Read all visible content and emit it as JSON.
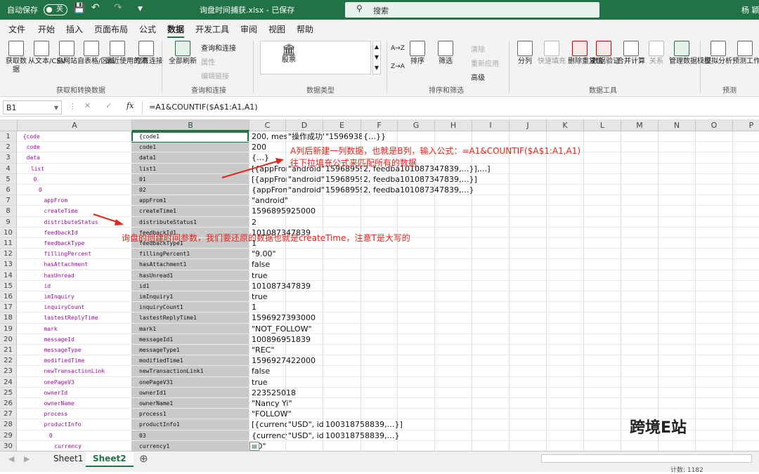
{
  "titlebar": {
    "autosave": "自动保存",
    "toggle": "关",
    "filename": "询盘时间捕获.xlsx - 已保存",
    "search": "搜索",
    "user": "杨 颖"
  },
  "tabs": [
    "文件",
    "开始",
    "插入",
    "页面布局",
    "公式",
    "数据",
    "开发工具",
    "审阅",
    "视图",
    "帮助"
  ],
  "ribbon": {
    "get": [
      "获取数据",
      "从文本/CSV",
      "自网站",
      "自表格/区域",
      "最近使用的源",
      "现有连接"
    ],
    "get_group": "获取和转换数据",
    "refresh": "全部刷新",
    "queries": "查询和连接",
    "props": "属性",
    "edit_links": "编辑链接",
    "query_group": "查询和连接",
    "stock": "股票",
    "types_group": "数据类型",
    "sort_az": "A→Z",
    "sort_za": "Z→A",
    "sort": "排序",
    "filter": "筛选",
    "clear": "清除",
    "reapply": "重新应用",
    "advanced": "高级",
    "sort_group": "排序和筛选",
    "tools": [
      "分列",
      "快速填充",
      "删除重复值",
      "数据验证",
      "合并计算",
      "关系",
      "管理数据模型"
    ],
    "tools_group": "数据工具",
    "forecast": [
      "模拟分析",
      "预测工作表"
    ],
    "forecast_group": "预测"
  },
  "formula_bar": {
    "namebox": "B1",
    "fx": "fx",
    "formula": "=A1&COUNTIF($A$1:A1,A1)"
  },
  "columns": [
    "A",
    "B",
    "C",
    "D",
    "E",
    "F",
    "G",
    "H",
    "I",
    "J",
    "K",
    "L",
    "M",
    "N",
    "O",
    "P"
  ],
  "rows": [
    {
      "n": "1",
      "a": "{code",
      "b": "{code1",
      "c": "200, mess",
      "d": "\"操作成功\"",
      "e": "\"1596938",
      "f": "{…}}"
    },
    {
      "n": "2",
      "a": "code",
      "b": "code1",
      "c": "200"
    },
    {
      "n": "3",
      "a": "data",
      "b": "data1",
      "c": "{…}"
    },
    {
      "n": "4",
      "a": "list",
      "b": "list1",
      "c": "[{appFron",
      "d": "\"android\"",
      "e": "15968959",
      "f": "2, feedba",
      "g": "101087347839,…}],…]"
    },
    {
      "n": "5",
      "a": "0",
      "b": "01",
      "c": "[{appFron",
      "d": "\"android\"",
      "e": "15968959",
      "f": "2, feedba",
      "g": "101087347839,…}]"
    },
    {
      "n": "6",
      "a": "0",
      "b": "02",
      "c": "{appFron",
      "d": "\"android\"",
      "e": "15968959",
      "f": "2, feedba",
      "g": "101087347839,…}"
    },
    {
      "n": "7",
      "a": "appFrom",
      "b": "appFrom1",
      "c": "\"android\""
    },
    {
      "n": "8",
      "a": "createTime",
      "b": "createTime1",
      "c": "1596895925000"
    },
    {
      "n": "9",
      "a": "distributeStatus",
      "b": "distributeStatus1",
      "c": "2"
    },
    {
      "n": "10",
      "a": "feedbackId",
      "b": "feedbackId1",
      "c": "101087347839"
    },
    {
      "n": "11",
      "a": "feedbackType",
      "b": "feedbackType1",
      "c": "1"
    },
    {
      "n": "12",
      "a": "fillingPercent",
      "b": "fillingPercent1",
      "c": "\"9.00\""
    },
    {
      "n": "13",
      "a": "hasAttachment",
      "b": "hasAttachment1",
      "c": "false"
    },
    {
      "n": "14",
      "a": "hasUnread",
      "b": "hasUnread1",
      "c": "true"
    },
    {
      "n": "15",
      "a": "id",
      "b": "id1",
      "c": "101087347839"
    },
    {
      "n": "16",
      "a": "imInquiry",
      "b": "imInquiry1",
      "c": "true"
    },
    {
      "n": "17",
      "a": "inquiryCount",
      "b": "inquiryCount1",
      "c": "1"
    },
    {
      "n": "18",
      "a": "lastestReplyTime",
      "b": "lastestReplyTime1",
      "c": "1596927393000"
    },
    {
      "n": "19",
      "a": "mark",
      "b": "mark1",
      "c": "\"NOT_FOLLOW\""
    },
    {
      "n": "20",
      "a": "messageId",
      "b": "messageId1",
      "c": "100896951839"
    },
    {
      "n": "21",
      "a": "messageType",
      "b": "messageType1",
      "c": "\"REC\""
    },
    {
      "n": "22",
      "a": "modifiedTime",
      "b": "modifiedTime1",
      "c": "1596927422000"
    },
    {
      "n": "23",
      "a": "newTransactionLink",
      "b": "newTransactionLink1",
      "c": "false"
    },
    {
      "n": "24",
      "a": "onePageV3",
      "b": "onePageV31",
      "c": "true"
    },
    {
      "n": "25",
      "a": "ownerId",
      "b": "ownerId1",
      "c": "223525018"
    },
    {
      "n": "26",
      "a": "ownerName",
      "b": "ownerName1",
      "c": "\"Nancy Yi\""
    },
    {
      "n": "27",
      "a": "process",
      "b": "process1",
      "c": "\"FOLLOW\""
    },
    {
      "n": "28",
      "a": "productInfo",
      "b": "productInfo1",
      "c": "[{currency",
      "d": "\"USD\", id",
      "e": "100318758839,…}]"
    },
    {
      "n": "29",
      "a": "0",
      "b": "03",
      "c": "{currency",
      "d": "\"USD\", id",
      "e": "100318758839,…}"
    },
    {
      "n": "30",
      "a": "currency",
      "b": "currency1",
      "c": "SD\""
    }
  ],
  "annotations": {
    "note1": "A列后新建一列数据，也就是B列，输入公式：=A1&COUNTIF($A$1:A1,A1)",
    "note2": "往下拉填充公式来匹配所有的数据",
    "note3": "询盘的创建时间参数，我们要还原的数据也就是createTime，注意T是大写的"
  },
  "sheets": [
    "Sheet1",
    "Sheet2"
  ],
  "watermark": "跨境E站",
  "status": "计数: 1182",
  "colors": {
    "accent": "#217346",
    "annotation": "#e8231a",
    "key_text": "#9e0b9e"
  }
}
